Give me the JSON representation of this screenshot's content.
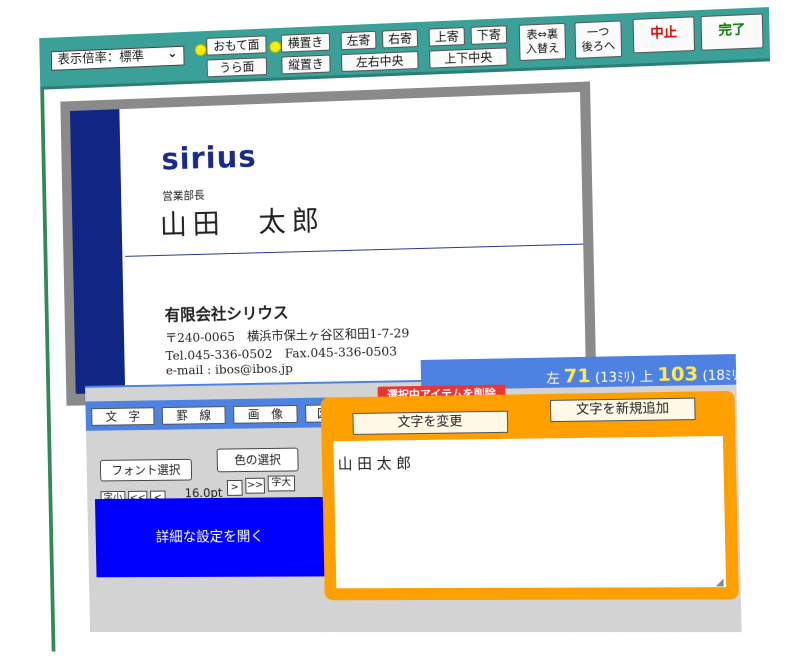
{
  "toolbar": {
    "zoom_select": "表示倍率：標準",
    "zoom_arrow": "⌄",
    "front": "おもて面",
    "back": "うら面",
    "horizontal": "横置き",
    "vertical": "縦置き",
    "align_left": "左寄",
    "align_right": "右寄",
    "center_h": "左右中央",
    "align_top": "上寄",
    "align_bottom": "下寄",
    "center_v": "上下中央",
    "swap_line1": "表⇔裏",
    "swap_line2": "入替え",
    "back_one_line1": "一つ",
    "back_one_line2": "後ろへ",
    "cancel": "中止",
    "done": "完了"
  },
  "card": {
    "logo": "sirius",
    "title": "営業部長",
    "name": "山田　太郎",
    "company": "有限会社シリウス",
    "address": "〒240-0065　横浜市保土ヶ谷区和田1-7-29",
    "tel": "Tel.045-336-0502　Fax.045-336-0503",
    "email": "e-mail : ibos@ibos.jp"
  },
  "status": {
    "left_label": "左",
    "left_value": "71",
    "left_mm": "(13ﾐﾘ)",
    "top_label": "上",
    "top_value": "103",
    "top_mm": "(18ﾐﾘ)"
  },
  "editor": {
    "tabs": [
      "文　字",
      "罫　線",
      "画　像",
      "図　形"
    ],
    "delete_selected": "選択中アイテムを削除",
    "font_select": "フォント選択",
    "color_select": "色の選択",
    "size_small": "字小",
    "size_dec_big": "<<",
    "size_dec": "<",
    "font_size": "16.0pt",
    "size_inc": ">",
    "size_inc_big": ">>",
    "size_large": "字大",
    "detail_open": "詳細な設定を開く",
    "change_text": "文字を変更",
    "add_text": "文字を新規追加",
    "text_value": "山 田 太 郎"
  },
  "colors": {
    "toolbar": "#3aa098",
    "card_stripe": "#112585",
    "logo": "#1a2a8c",
    "status_bar": "#4e82e2",
    "panel": "#ff9f00",
    "detail_button": "#0000ff",
    "delete_button": "#e33333",
    "cancel_text": "#dd0000",
    "done_text": "#007700"
  }
}
